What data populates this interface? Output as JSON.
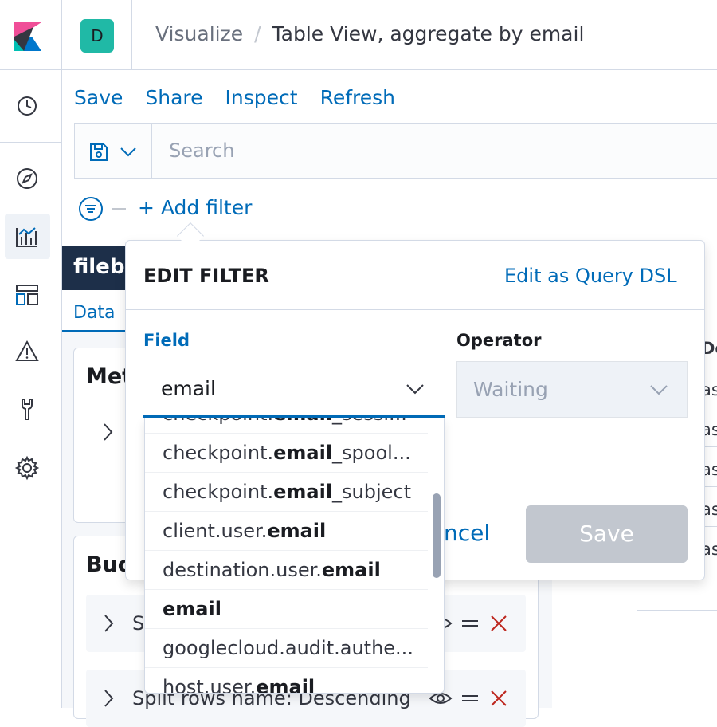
{
  "header": {
    "space_initial": "D",
    "breadcrumbs": [
      "Visualize",
      "Table View, aggregate by email"
    ],
    "separator": "/"
  },
  "nav": {
    "icons": [
      "clock-icon",
      "compass-icon",
      "visualize-icon",
      "dashboard-icon",
      "alert-icon",
      "wrench-icon",
      "gear-icon"
    ]
  },
  "topmenu": {
    "items": [
      "Save",
      "Share",
      "Inspect",
      "Refresh"
    ]
  },
  "query": {
    "placeholder": "Search"
  },
  "filters": {
    "add_label": "+ Add filter"
  },
  "editor": {
    "index_name": "filebe",
    "tab_data": "Data",
    "metrics_title": "Met",
    "buckets_title": "Buc",
    "split_rows": [
      {
        "label": "S"
      },
      {
        "label": "Split rows name: Descending"
      }
    ],
    "right_col": [
      "De",
      "as",
      "as",
      "as",
      "as",
      "as"
    ]
  },
  "popover": {
    "title": "EDIT FILTER",
    "dsl_link": "Edit as Query DSL",
    "field_label": "Field",
    "field_value": "email",
    "operator_label": "Operator",
    "operator_value": "Waiting",
    "cancel_label": "ncel",
    "save_label": "Save"
  },
  "dropdown": {
    "options": [
      {
        "pre": "checkpoint.",
        "match": "email",
        "post": "_sessi..."
      },
      {
        "pre": "checkpoint.",
        "match": "email",
        "post": "_spool..."
      },
      {
        "pre": "checkpoint.",
        "match": "email",
        "post": "_subject"
      },
      {
        "pre": "client.user.",
        "match": "email",
        "post": ""
      },
      {
        "pre": "destination.user.",
        "match": "email",
        "post": ""
      },
      {
        "pre": "",
        "match": "email",
        "post": ""
      },
      {
        "pre": "googlecloud.audit.authe...",
        "match": "",
        "post": ""
      },
      {
        "pre": "host.user.",
        "match": "email",
        "post": ""
      }
    ]
  },
  "colors": {
    "link": "#006bb8",
    "nav_dark": "#1d2f49",
    "avatar": "#20b9a6",
    "danger": "#bd271e"
  }
}
